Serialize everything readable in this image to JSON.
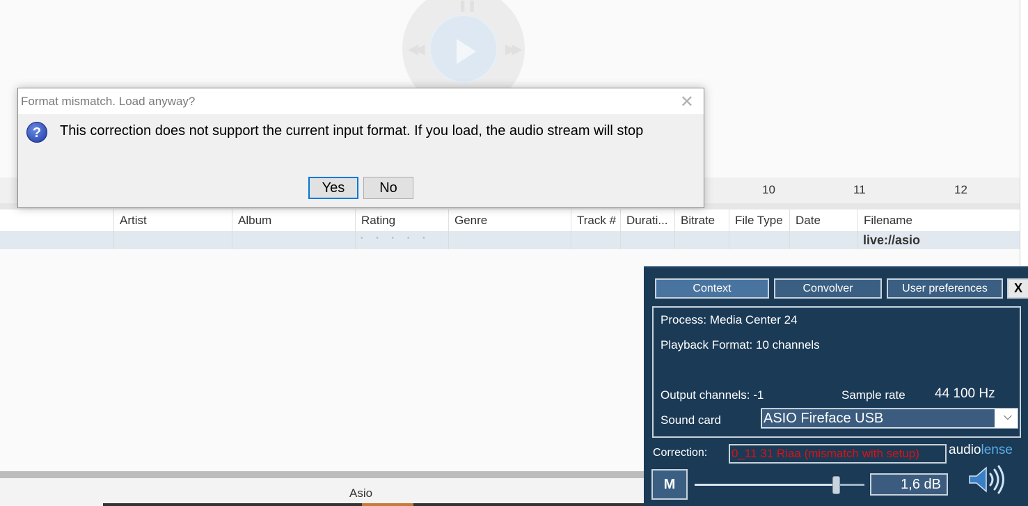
{
  "dialog": {
    "title": "Format mismatch. Load anyway?",
    "close_glyph": "✕",
    "icon_glyph": "?",
    "message": "This correction does not support the current input format. If you load, the audio stream will stop",
    "yes_label": "Yes",
    "no_label": "No"
  },
  "ruler": {
    "ticks": [
      "10",
      "11",
      "12"
    ]
  },
  "table": {
    "columns": [
      "Artist",
      "Album",
      "Rating",
      "Genre",
      "Track #",
      "Durati...",
      "Bitrate",
      "File Type",
      "Date",
      "Filename"
    ],
    "row": {
      "rating": "• • • • •",
      "filename": "live://asio"
    }
  },
  "statusbar": {
    "text": "Asio"
  },
  "audiolense": {
    "tabs": {
      "context": "Context",
      "convolver": "Convolver",
      "user_prefs": "User preferences"
    },
    "close_label": "X",
    "process": "Process: Media Center 24",
    "playback_format": "Playback Format: 10 channels",
    "output_channels": "Output channels: -1",
    "sample_rate_label": "Sample rate",
    "sample_rate_value": "44 100 Hz",
    "sound_card_label": "Sound card",
    "sound_card_value": "ASIO Fireface USB",
    "correction_label": "Correction:",
    "correction_value": "0_11 31 Riaa (mismatch with setup)",
    "logo_part1": "audio",
    "logo_part2": "lense",
    "mute_label": "M",
    "volume_display": "1,6 dB",
    "volume_level": 0.83
  },
  "colors": {
    "panel_bg": "#1b3a56",
    "accent_blue": "#0078d7",
    "error_red": "#e01010",
    "logo_blue": "#5aaee8"
  }
}
